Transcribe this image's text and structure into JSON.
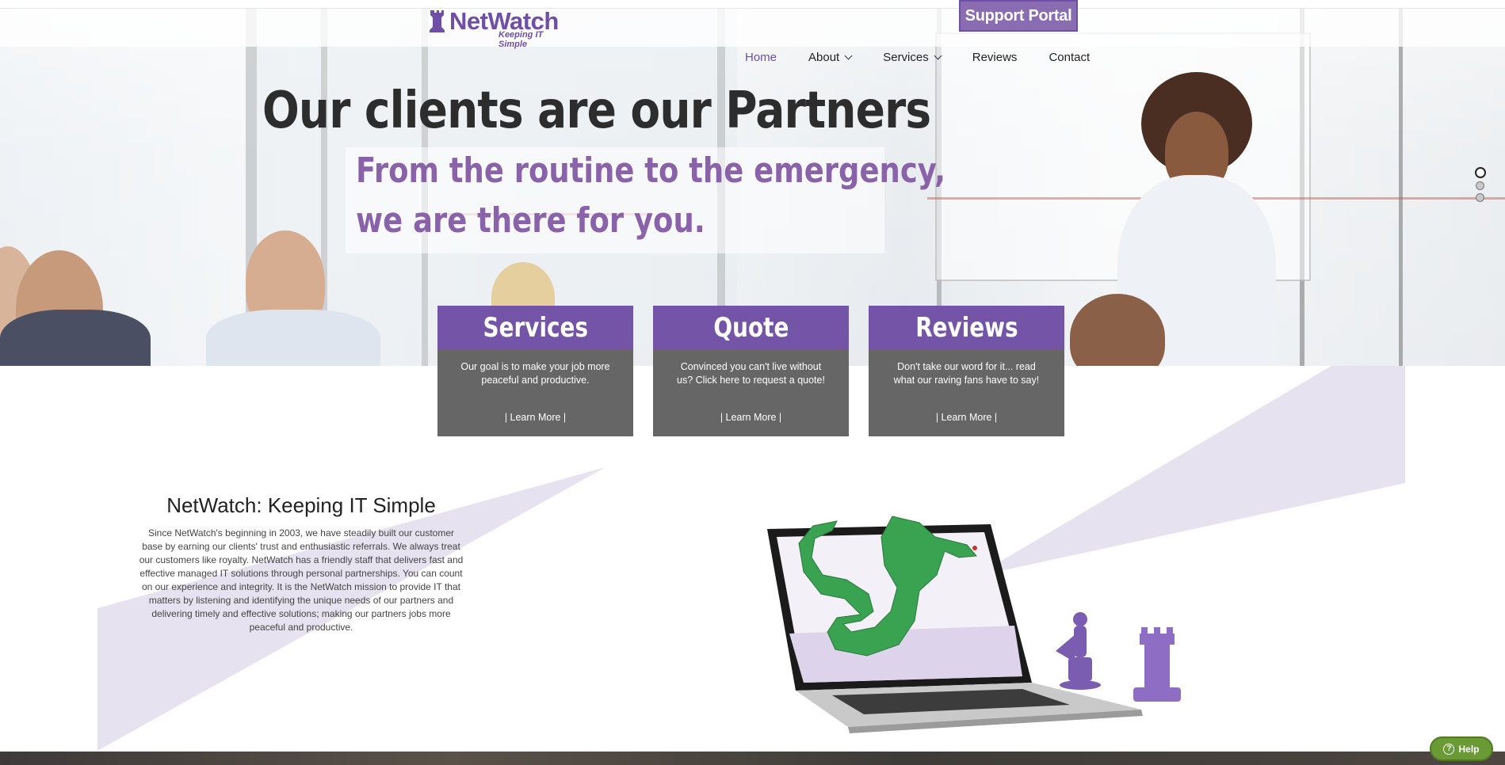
{
  "header": {
    "logo_name": "NetWatch",
    "logo_tagline": "Keeping IT Simple",
    "support_label": "Support Portal"
  },
  "nav": {
    "items": [
      {
        "label": "Home",
        "active": true,
        "dropdown": false
      },
      {
        "label": "About",
        "active": false,
        "dropdown": true
      },
      {
        "label": "Services",
        "active": false,
        "dropdown": true
      },
      {
        "label": "Reviews",
        "active": false,
        "dropdown": false
      },
      {
        "label": "Contact",
        "active": false,
        "dropdown": false
      }
    ]
  },
  "hero": {
    "headline": "Our clients are our Partners",
    "sub_line1": "From the routine to the emergency,",
    "sub_line2": "we are there for you.",
    "slides": 3,
    "active_slide": 1
  },
  "cards": [
    {
      "title": "Services",
      "text": "Our goal is to make your job more peaceful and productive.",
      "link": "| Learn More |"
    },
    {
      "title": "Quote",
      "text": "Convinced you can't live without us? Click here to request a quote!",
      "link": "| Learn More |"
    },
    {
      "title": "Reviews",
      "text": "Don't take our word for it... read what our raving fans have to say!",
      "link": "| Learn More |"
    }
  ],
  "about": {
    "title": "NetWatch: Keeping IT Simple",
    "text": "Since NetWatch's beginning in 2003, we have steadily built our customer base by earning our clients' trust and enthusiastic referrals. We always treat our customers like royalty. NetWatch has a friendly staff that delivers fast and effective managed IT solutions through personal partnerships. You can count on our experience and integrity. It is the NetWatch mission to provide IT that matters by listening and identifying the unique needs of our partners and delivering timely and effective solutions; making our partners jobs more peaceful and productive."
  },
  "help": {
    "label": "Help"
  },
  "colors": {
    "brand_purple": "#7454a6",
    "headline_purple": "#8a62aa",
    "card_gray": "#666666",
    "help_green": "#6a9a36"
  }
}
